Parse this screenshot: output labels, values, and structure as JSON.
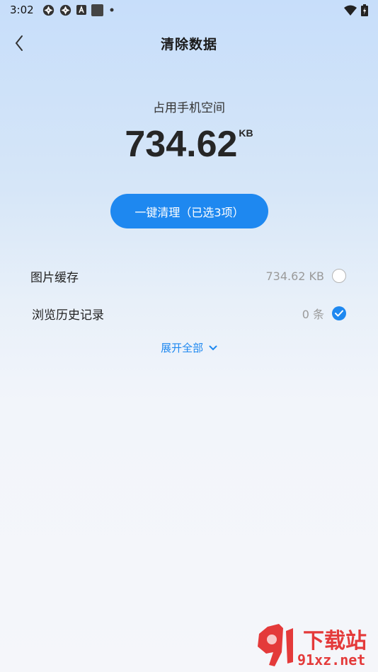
{
  "status_bar": {
    "time": "3:02",
    "left_icons": [
      "aperture-icon",
      "aperture-icon",
      "a-box-icon",
      "square-icon",
      "dot-icon"
    ],
    "right_icons": [
      "wifi-icon",
      "battery-charging-icon"
    ]
  },
  "header": {
    "title": "清除数据",
    "back_icon": "chevron-left-icon"
  },
  "usage": {
    "label": "占用手机空间",
    "value": "734.62",
    "unit": "KB"
  },
  "clean_button": {
    "label": "一键清理（已选3项）"
  },
  "items": [
    {
      "label": "图片缓存",
      "size": "734.62 KB",
      "checked": false
    },
    {
      "label": "浏览历史记录",
      "size": "0 条",
      "checked": true
    }
  ],
  "expand": {
    "label": "展开全部",
    "icon": "chevron-down-icon"
  },
  "watermark": {
    "logo_text": "9",
    "brand_cn": "下载站",
    "brand_en": "91xz.net"
  },
  "colors": {
    "accent": "#1e88f0",
    "logo_red": "#e43a3a"
  }
}
